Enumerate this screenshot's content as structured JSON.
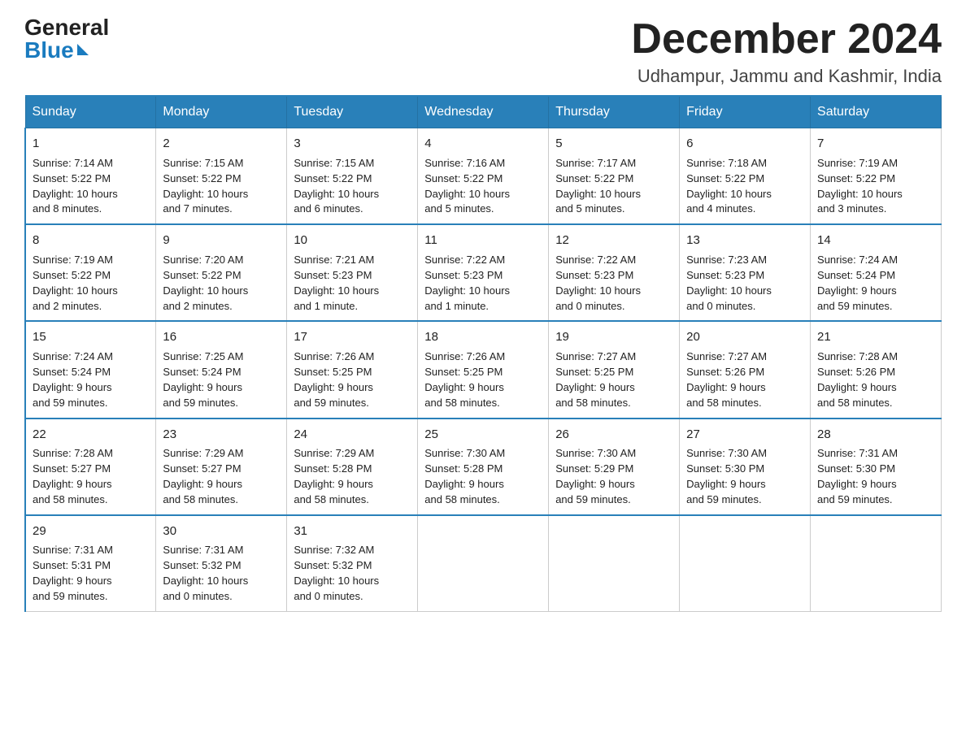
{
  "logo": {
    "general": "General",
    "blue": "Blue"
  },
  "title": "December 2024",
  "location": "Udhampur, Jammu and Kashmir, India",
  "weekdays": [
    "Sunday",
    "Monday",
    "Tuesday",
    "Wednesday",
    "Thursday",
    "Friday",
    "Saturday"
  ],
  "weeks": [
    [
      {
        "day": "1",
        "info": "Sunrise: 7:14 AM\nSunset: 5:22 PM\nDaylight: 10 hours\nand 8 minutes."
      },
      {
        "day": "2",
        "info": "Sunrise: 7:15 AM\nSunset: 5:22 PM\nDaylight: 10 hours\nand 7 minutes."
      },
      {
        "day": "3",
        "info": "Sunrise: 7:15 AM\nSunset: 5:22 PM\nDaylight: 10 hours\nand 6 minutes."
      },
      {
        "day": "4",
        "info": "Sunrise: 7:16 AM\nSunset: 5:22 PM\nDaylight: 10 hours\nand 5 minutes."
      },
      {
        "day": "5",
        "info": "Sunrise: 7:17 AM\nSunset: 5:22 PM\nDaylight: 10 hours\nand 5 minutes."
      },
      {
        "day": "6",
        "info": "Sunrise: 7:18 AM\nSunset: 5:22 PM\nDaylight: 10 hours\nand 4 minutes."
      },
      {
        "day": "7",
        "info": "Sunrise: 7:19 AM\nSunset: 5:22 PM\nDaylight: 10 hours\nand 3 minutes."
      }
    ],
    [
      {
        "day": "8",
        "info": "Sunrise: 7:19 AM\nSunset: 5:22 PM\nDaylight: 10 hours\nand 2 minutes."
      },
      {
        "day": "9",
        "info": "Sunrise: 7:20 AM\nSunset: 5:22 PM\nDaylight: 10 hours\nand 2 minutes."
      },
      {
        "day": "10",
        "info": "Sunrise: 7:21 AM\nSunset: 5:23 PM\nDaylight: 10 hours\nand 1 minute."
      },
      {
        "day": "11",
        "info": "Sunrise: 7:22 AM\nSunset: 5:23 PM\nDaylight: 10 hours\nand 1 minute."
      },
      {
        "day": "12",
        "info": "Sunrise: 7:22 AM\nSunset: 5:23 PM\nDaylight: 10 hours\nand 0 minutes."
      },
      {
        "day": "13",
        "info": "Sunrise: 7:23 AM\nSunset: 5:23 PM\nDaylight: 10 hours\nand 0 minutes."
      },
      {
        "day": "14",
        "info": "Sunrise: 7:24 AM\nSunset: 5:24 PM\nDaylight: 9 hours\nand 59 minutes."
      }
    ],
    [
      {
        "day": "15",
        "info": "Sunrise: 7:24 AM\nSunset: 5:24 PM\nDaylight: 9 hours\nand 59 minutes."
      },
      {
        "day": "16",
        "info": "Sunrise: 7:25 AM\nSunset: 5:24 PM\nDaylight: 9 hours\nand 59 minutes."
      },
      {
        "day": "17",
        "info": "Sunrise: 7:26 AM\nSunset: 5:25 PM\nDaylight: 9 hours\nand 59 minutes."
      },
      {
        "day": "18",
        "info": "Sunrise: 7:26 AM\nSunset: 5:25 PM\nDaylight: 9 hours\nand 58 minutes."
      },
      {
        "day": "19",
        "info": "Sunrise: 7:27 AM\nSunset: 5:25 PM\nDaylight: 9 hours\nand 58 minutes."
      },
      {
        "day": "20",
        "info": "Sunrise: 7:27 AM\nSunset: 5:26 PM\nDaylight: 9 hours\nand 58 minutes."
      },
      {
        "day": "21",
        "info": "Sunrise: 7:28 AM\nSunset: 5:26 PM\nDaylight: 9 hours\nand 58 minutes."
      }
    ],
    [
      {
        "day": "22",
        "info": "Sunrise: 7:28 AM\nSunset: 5:27 PM\nDaylight: 9 hours\nand 58 minutes."
      },
      {
        "day": "23",
        "info": "Sunrise: 7:29 AM\nSunset: 5:27 PM\nDaylight: 9 hours\nand 58 minutes."
      },
      {
        "day": "24",
        "info": "Sunrise: 7:29 AM\nSunset: 5:28 PM\nDaylight: 9 hours\nand 58 minutes."
      },
      {
        "day": "25",
        "info": "Sunrise: 7:30 AM\nSunset: 5:28 PM\nDaylight: 9 hours\nand 58 minutes."
      },
      {
        "day": "26",
        "info": "Sunrise: 7:30 AM\nSunset: 5:29 PM\nDaylight: 9 hours\nand 59 minutes."
      },
      {
        "day": "27",
        "info": "Sunrise: 7:30 AM\nSunset: 5:30 PM\nDaylight: 9 hours\nand 59 minutes."
      },
      {
        "day": "28",
        "info": "Sunrise: 7:31 AM\nSunset: 5:30 PM\nDaylight: 9 hours\nand 59 minutes."
      }
    ],
    [
      {
        "day": "29",
        "info": "Sunrise: 7:31 AM\nSunset: 5:31 PM\nDaylight: 9 hours\nand 59 minutes."
      },
      {
        "day": "30",
        "info": "Sunrise: 7:31 AM\nSunset: 5:32 PM\nDaylight: 10 hours\nand 0 minutes."
      },
      {
        "day": "31",
        "info": "Sunrise: 7:32 AM\nSunset: 5:32 PM\nDaylight: 10 hours\nand 0 minutes."
      },
      {
        "day": "",
        "info": ""
      },
      {
        "day": "",
        "info": ""
      },
      {
        "day": "",
        "info": ""
      },
      {
        "day": "",
        "info": ""
      }
    ]
  ]
}
